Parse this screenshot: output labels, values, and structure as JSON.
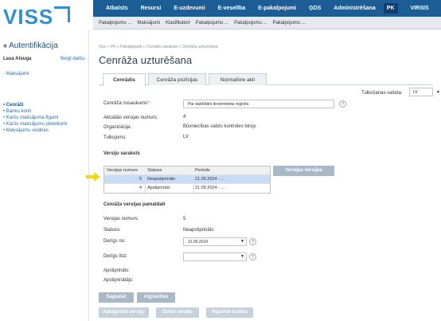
{
  "header": {
    "logo_text": "VISS",
    "topnav": [
      "Atbalsts",
      "Resursi",
      "E-uzdevumi",
      "E-veselība",
      "E-pakalpojumi",
      "ĢDS",
      "Administrēšana",
      "PK",
      "VIRSIS"
    ],
    "topnav_active": "PK",
    "subnav": [
      "Pakalpojumu ...",
      "Maksājumi",
      "Klasifikatori",
      "Pakalpojumu ...",
      "Pakalpojumu ...",
      "Pakalpojumu ..."
    ]
  },
  "sidebar": {
    "title": "Autentifikācija",
    "user": "Lasa Atsuga",
    "logout": "Beigt darbu",
    "payments": "Maksājumi",
    "links": [
      "Cenrāži",
      "Banku konti",
      "Karšu maksājuma figumi",
      "Karšu maksājumu pieteikumi",
      "Maksājumu veidnes"
    ]
  },
  "main": {
    "breadcrumb": "Viss » PK » Pakalpojumi » Cenrāžu saraksts » Cenrāža uzturēšana",
    "title": "Cenrāža uzturēšana",
    "tabs": [
      "Cenrādis",
      "Cenrāža pozīcijas",
      "Normatīvie akti"
    ],
    "language_label": "Tulkošanas valoda:",
    "language_value": "LV",
    "form": {
      "name_label": "Cenrāža nosaukums",
      "name_required": "*:",
      "name_value": "Par darbībām Iievlemnieta reģistra",
      "current_version_label": "Aktuālās versijas numurs:",
      "current_version_value": "4",
      "organization_label": "Organizācija:",
      "organization_value": "Būvniecības valsts kontroles birojs",
      "translation_label": "Tulkojums:",
      "translation_value": "LV"
    },
    "versions": {
      "title": "Versiju saraksts",
      "headers": [
        "Versijas numurs",
        "Statuss",
        "Periods"
      ],
      "rows": [
        {
          "number": "5",
          "status": "Neapstiprināts",
          "period": "21.05.2024 - ..."
        },
        {
          "number": "4",
          "status": "Apstiprināts",
          "period": "21.05.2024 - ..."
        }
      ],
      "compare_button": "Versijas versijas"
    },
    "version_base": {
      "title": "Cenrāža versijas pamatdati",
      "number_label": "Versijas numurs:",
      "number_value": "5",
      "status_label": "Statuss:",
      "status_value": "Neapstiprināts",
      "valid_from_label": "Derīgs no:",
      "valid_from_value": "31.05.2024",
      "valid_to_label": "Derīgs līdz:",
      "valid_to_value": "",
      "approved_label": "Apstiprināts:",
      "approver_label": "Apstiprinātājs:"
    },
    "buttons": {
      "save": "Saglabāt",
      "cancel": "Atgriezties",
      "approve": "Apstiprināt versiju",
      "delete": "Dzēst versiju",
      "renew": "Atjaunot kontus"
    }
  },
  "colors": {
    "topnav_bg": "#1d5d96",
    "accent": "#2f8fd0",
    "marker": "#f4d21c"
  }
}
